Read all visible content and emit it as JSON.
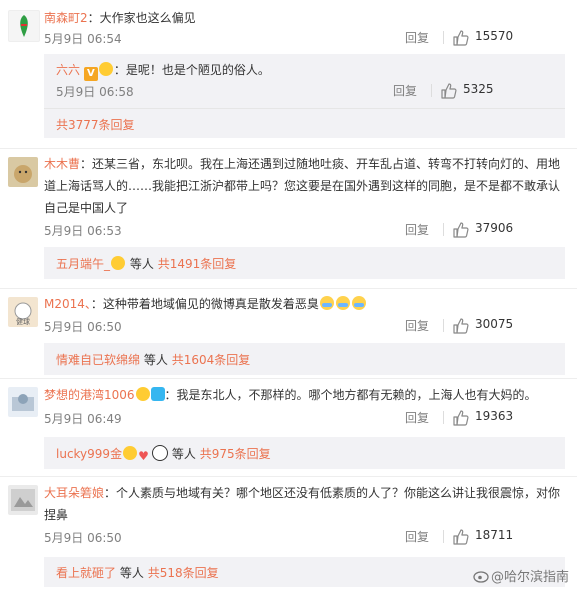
{
  "reply_label": "回复",
  "comments": [
    {
      "user": "南森町2",
      "text": "：大作家也这么偏见",
      "time": "5月9日 06:54",
      "likes": "15570",
      "sub_user": "六六",
      "sub_text": "：是呢！也是个陋见的俗人。",
      "sub_time": "5月9日 06:58",
      "sub_likes": "5325",
      "more": "共3777条回复"
    },
    {
      "user": "木木曹",
      "text_line1": "：还某三省，东北呗。我在上海还遇到过随地吐痰、开车乱占道、转弯不打转向灯的、用地",
      "text_line2": "道上海话骂人的……我能把江浙沪都带上吗？您这要是在国外遇到这样的同胞，是不是都不敢承认",
      "text_line3": "自己是中国人了",
      "time": "5月9日 06:53",
      "likes": "37906",
      "more_user": "五月端午_",
      "more_mid": "等人",
      "more_count": "共1491条回复"
    },
    {
      "user": "M2014、",
      "text": "：这种带着地域偏见的微博真是散发着恶臭",
      "time": "5月9日 06:50",
      "likes": "30075",
      "more_user": "情难自已软绵绵",
      "more_mid": "等人",
      "more_count": "共1604条回复"
    },
    {
      "user": "梦想的港湾1006",
      "text": "：我是东北人，不那样的。哪个地方都有无赖的，上海人也有大妈的。",
      "time": "5月9日 06:49",
      "likes": "19363",
      "more_user": "lucky999金",
      "more_mid": "等人",
      "more_count": "共975条回复"
    },
    {
      "user": "大耳朵箬娘",
      "text_line1": "：个人素质与地域有关？哪个地区还没有低素质的人了？你能这么讲让我很震惊，对你",
      "text_line2": "捏鼻",
      "time": "5月9日 06:50",
      "likes": "18711",
      "more_user": "看上就砸了",
      "more_mid": "等人",
      "more_count": "共518条回复"
    }
  ],
  "watermark": "@哈尔滨指南",
  "colors": {
    "accent": "#eb7350",
    "sub_bg": "#f2f2f5",
    "meta": "#808080"
  }
}
